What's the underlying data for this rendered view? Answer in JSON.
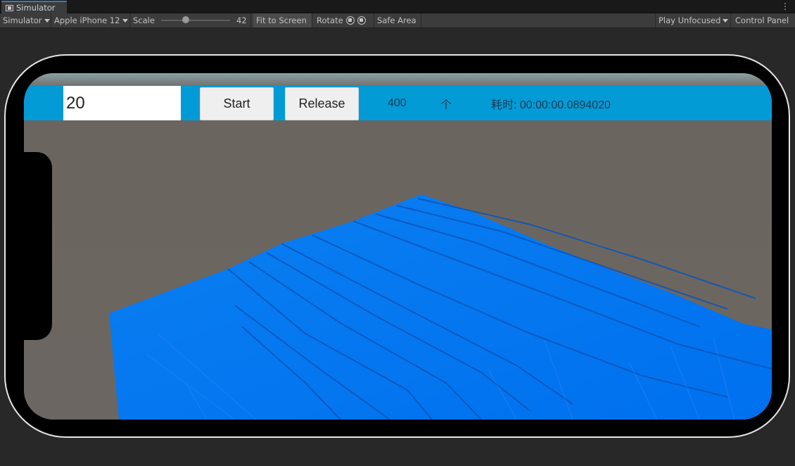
{
  "window": {
    "tab_title": "Simulator",
    "menu_icon": "kebab-icon"
  },
  "toolbar": {
    "simulator_dropdown": "Simulator",
    "device_dropdown": "Apple iPhone 12",
    "scale_label": "Scale",
    "scale_value": "42",
    "fit_to_screen": "Fit to Screen",
    "rotate_label": "Rotate",
    "rotate_left_icon": "rotate-left-icon",
    "rotate_right_icon": "rotate-right-icon",
    "safe_area": "Safe Area",
    "play_mode_dropdown": "Play Unfocused",
    "control_panel": "Control Panel"
  },
  "game_ui": {
    "count_input_value": "20",
    "start_button": "Start",
    "release_button": "Release",
    "object_count": "400",
    "count_unit": "个",
    "elapsed_text": "耗时: 00:00:00.0894020"
  },
  "colors": {
    "ui_bar": "#029bd6",
    "cube_blue": "#0076f2",
    "ground": "#6b6560"
  }
}
